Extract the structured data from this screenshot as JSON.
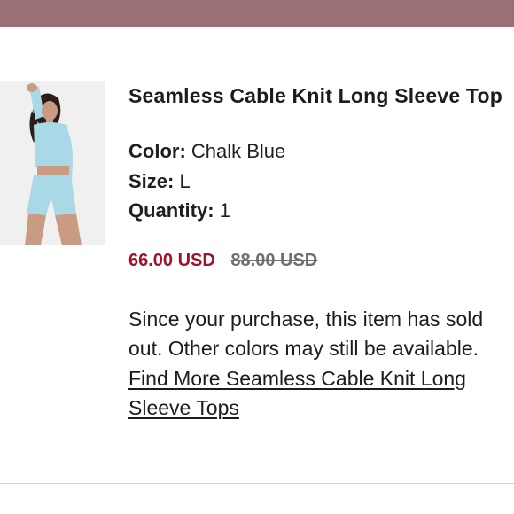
{
  "product": {
    "title": "Seamless Cable Knit Long Sleeve Top",
    "color_label": "Color:",
    "color_value": "Chalk Blue",
    "size_label": "Size:",
    "size_value": "L",
    "quantity_label": "Quantity:",
    "quantity_value": "1",
    "price_sale": "66.00 USD",
    "price_original": "88.00 USD",
    "soldout_message": "Since your purchase, this item has sold out. Other colors may still be available.",
    "find_more_link": "Find More Seamless Cable Knit Long Sleeve Tops"
  },
  "colors": {
    "header_bar": "#9a6f76",
    "sale_price": "#a0112b",
    "original_price": "#6f6f6f",
    "product_garment": "#a9d8e6"
  }
}
